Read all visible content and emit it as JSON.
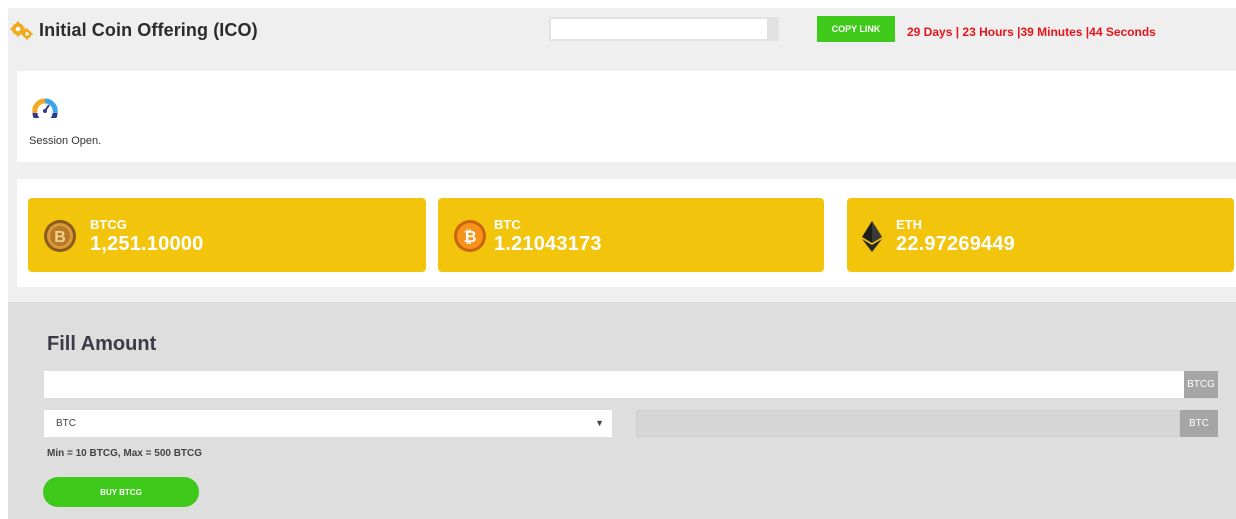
{
  "header": {
    "title": "Initial Coin Offering (ICO)",
    "link_value": "",
    "copy_label": "COPY LINK",
    "countdown": "29 Days | 23 Hours |39 Minutes |44 Seconds"
  },
  "session": {
    "icon": "speedometer-icon",
    "status": "Session Open."
  },
  "balances": [
    {
      "label": "BTCG",
      "value": "1,251.10000",
      "icon": "btcg-coin-icon"
    },
    {
      "label": "BTC",
      "value": "1.21043173",
      "icon": "bitcoin-icon"
    },
    {
      "label": "ETH",
      "value": "22.97269449",
      "icon": "ethereum-icon"
    }
  ],
  "fill": {
    "title": "Fill Amount",
    "amount_value": "",
    "amount_unit": "BTCG",
    "currency_selected": "BTC",
    "price_value": "",
    "price_unit": "BTC",
    "limits": "Min = 10 BTCG, Max = 500 BTCG",
    "buy_label": "BUY BTCG"
  },
  "colors": {
    "card": "#f2c40c",
    "accent_green": "#3fc91a",
    "countdown_red": "#e8141b",
    "gear_orange": "#f0a91c"
  }
}
